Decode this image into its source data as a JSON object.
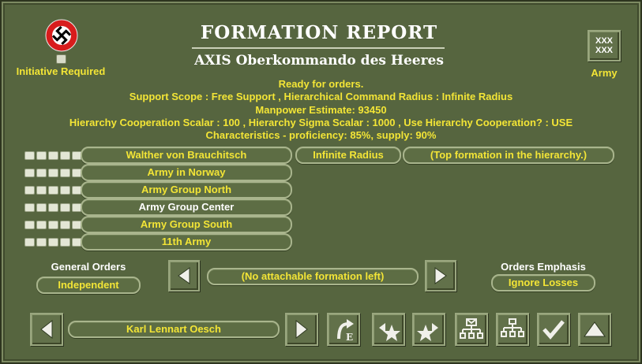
{
  "header": {
    "title": "FORMATION REPORT",
    "subtitle": "AXIS Oberkommando des Heeres",
    "initiative_label": "Initiative Required",
    "army_badge": "XXX\nXXX",
    "army_label": "Army"
  },
  "status": {
    "line1": "Ready for orders.",
    "line2": "Support Scope :  Free Support ,  Hierarchical Command Radius :  Infinite Radius",
    "line3": "Manpower Estimate: 93450",
    "line4": "Hierarchy Cooperation Scalar :  100 ,  Hierarchy Sigma Scalar :  1000 ,  Use Hierarchy Cooperation? :  USE",
    "line5": "Characteristics - proficiency: 85%, supply: 90%"
  },
  "formations": [
    {
      "name": "Walther von Brauchitsch",
      "highlight": false
    },
    {
      "name": "Army in Norway",
      "highlight": false
    },
    {
      "name": "Army Group North",
      "highlight": false
    },
    {
      "name": "Army Group Center",
      "highlight": true
    },
    {
      "name": "Army Group South",
      "highlight": false
    },
    {
      "name": "11th Army",
      "highlight": false
    }
  ],
  "commander_radius": "Infinite Radius",
  "commander_note": "(Top formation in the hierarchy.)",
  "orders": {
    "general_orders_label": "General Orders",
    "general_orders_value": "Independent",
    "attach_text": "(No attachable formation left)",
    "emphasis_label": "Orders Emphasis",
    "emphasis_value": "Ignore Losses"
  },
  "bottom": {
    "leader_name": "Karl Lennart Oesch",
    "icons": [
      "left-arrow-icon",
      "right-arrow-icon",
      "return-e-icon",
      "star-left-icon",
      "star-right-icon",
      "hierarchy-mail-icon",
      "hierarchy-icon",
      "check-icon",
      "up-arrow-icon"
    ]
  },
  "colors": {
    "background": "#56653f",
    "text_accent": "#f3e536",
    "text_white": "#ffffff"
  }
}
